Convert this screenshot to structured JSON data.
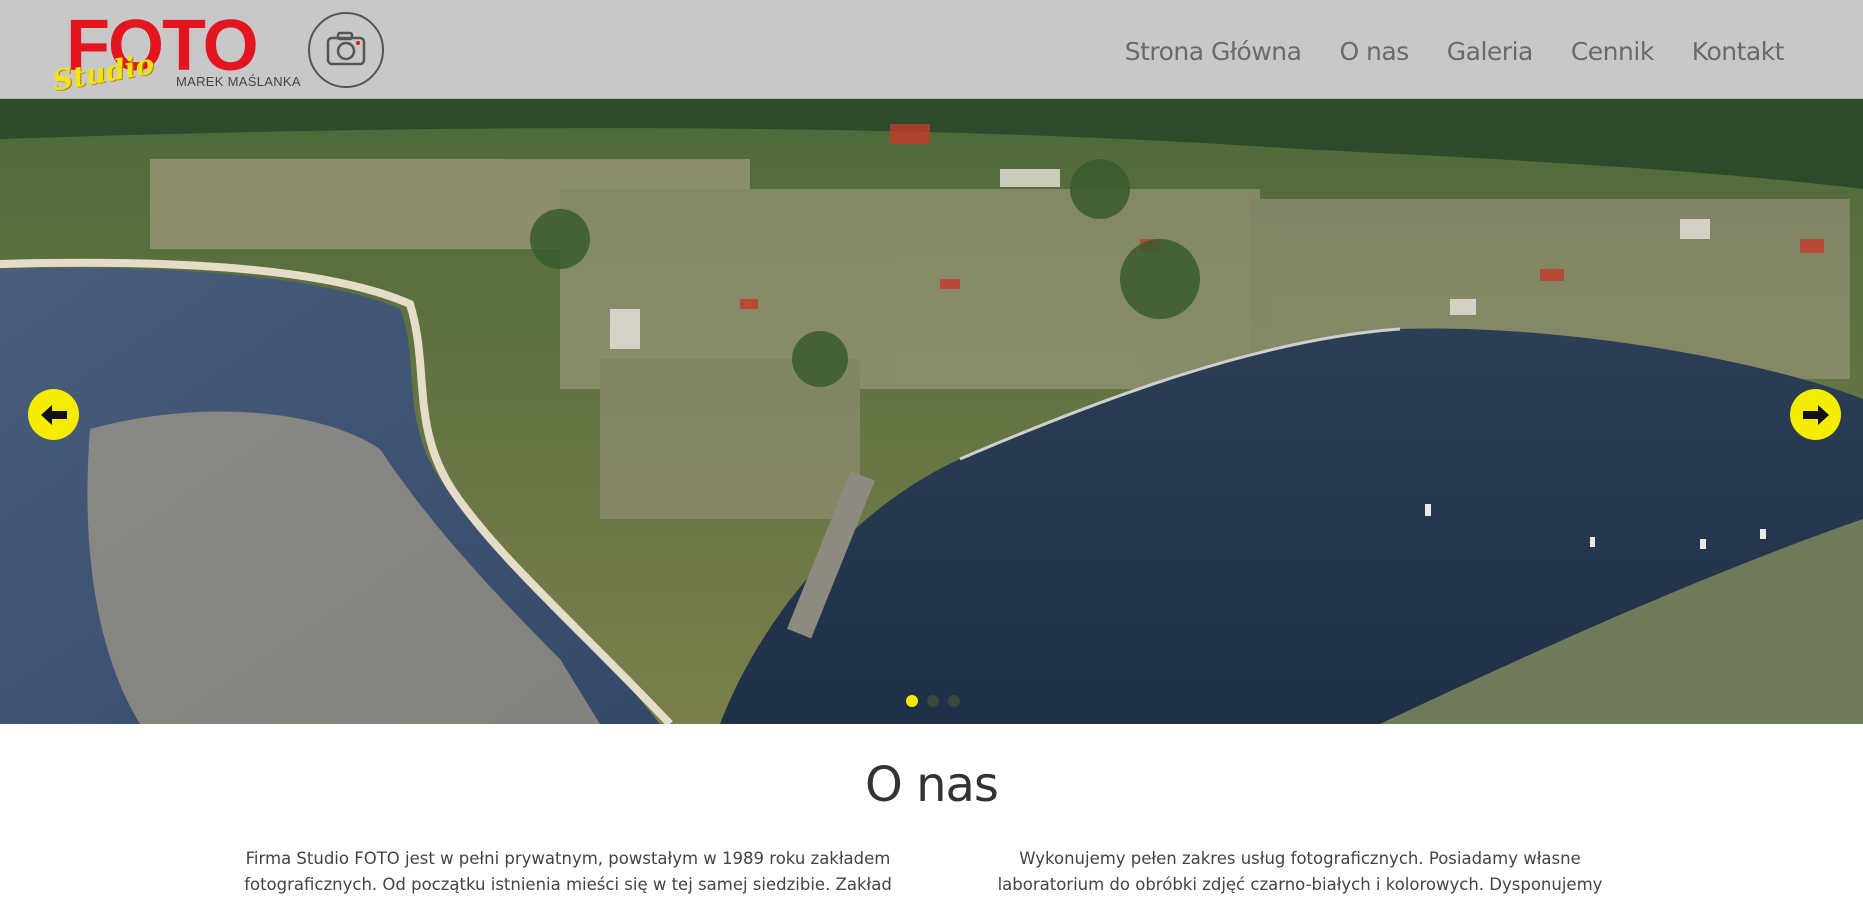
{
  "logo": {
    "brand": "FOTO",
    "studio": "Studio",
    "owner": "MAREK MAŚLANKA"
  },
  "nav": {
    "items": [
      "Strona Główna",
      "O nas",
      "Galeria",
      "Cennik",
      "Kontakt"
    ]
  },
  "slider": {
    "prev_icon": "arrow-left-icon",
    "next_icon": "arrow-right-icon",
    "slide_count": 3,
    "active_slide": 1
  },
  "about": {
    "title": "O nas",
    "left_text": "Firma Studio FOTO jest w pełni prywatnym, powstałym w 1989 roku zakładem fotograficznych. Od początku istnienia mieści się w tej samej siedzibie. Zakład prowadzony",
    "right_text": "Wykonujemy pełen zakres usług fotograficznych. Posiadamy własne laboratorium do obróbki zdjęć czarno-białych i kolorowych. Dysponujemy profesjonalnym studiem"
  },
  "colors": {
    "accent": "#f5ec00",
    "brand_red": "#e3151e",
    "header_bg": "#c8c8c8"
  }
}
